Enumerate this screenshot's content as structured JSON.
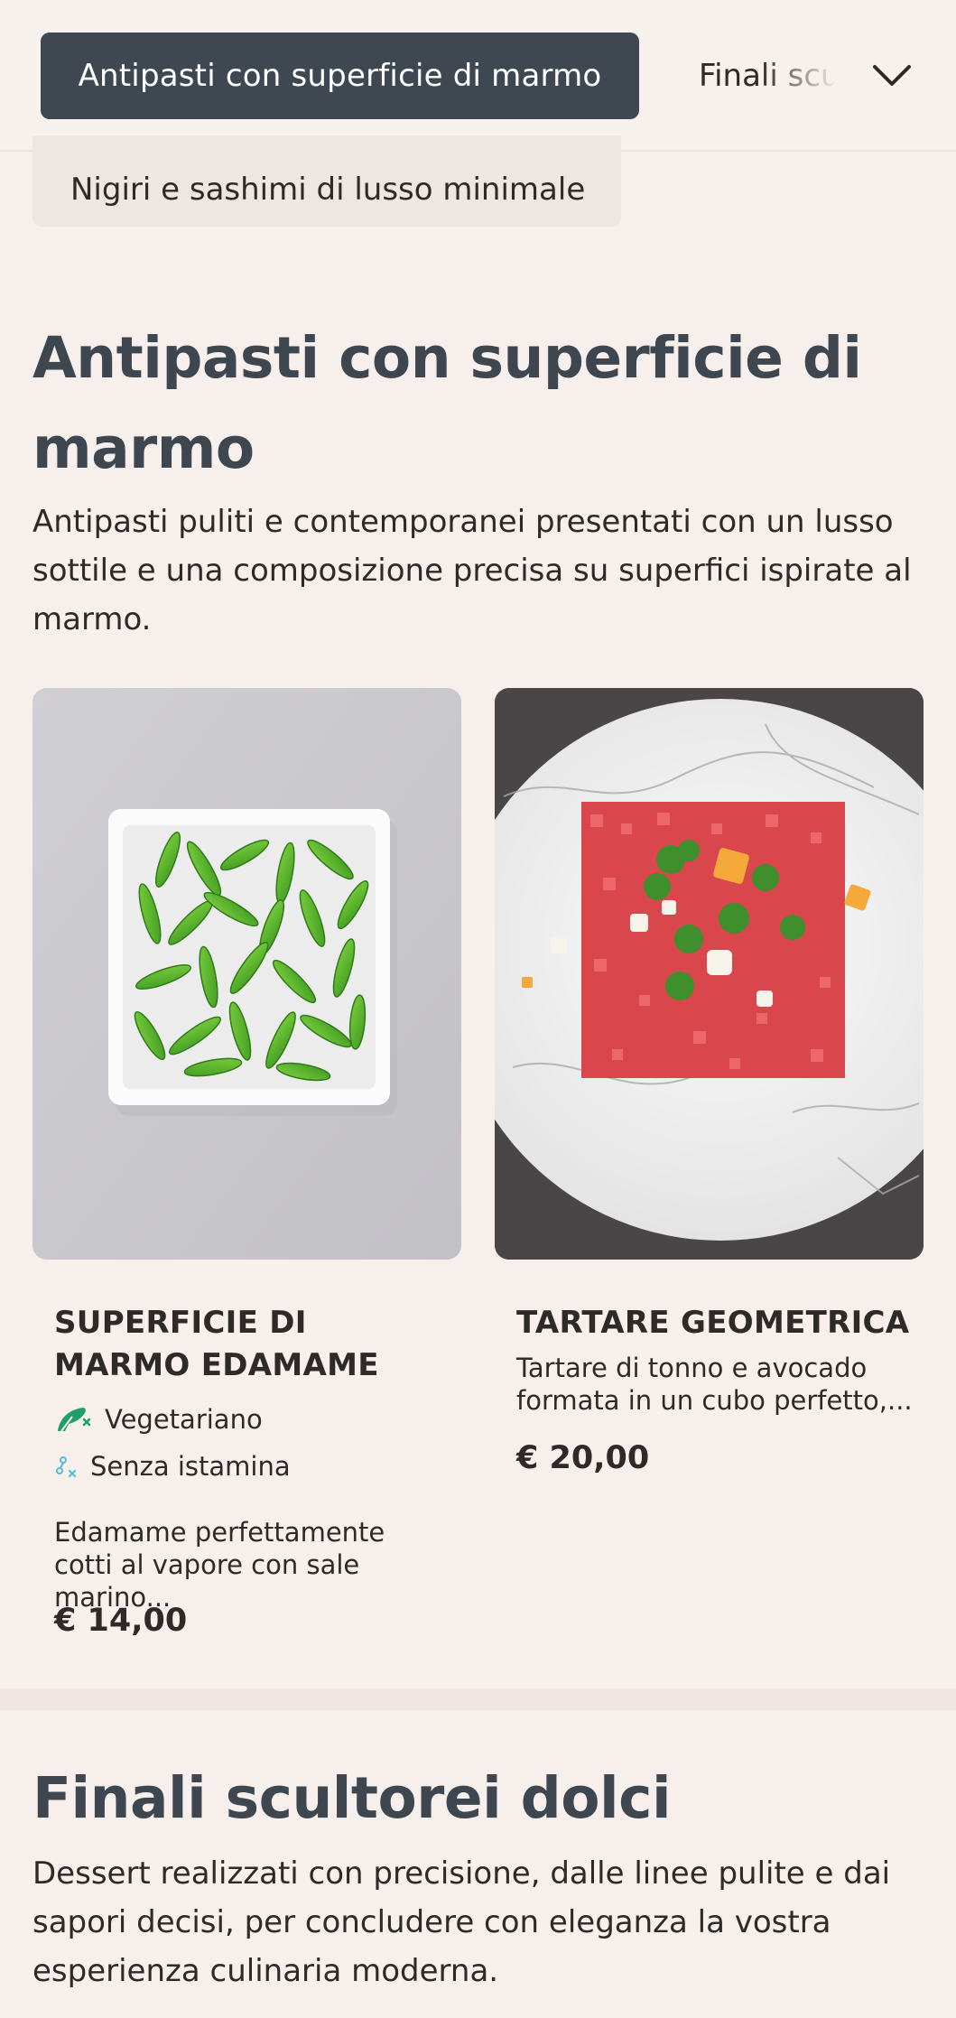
{
  "category_nav": {
    "active": "Antipasti con superficie di marmo",
    "next": "Finali scultorei dolci",
    "secondary_chip": "Nigiri e sashimi di lusso minimale"
  },
  "section_starters": {
    "title": "Antipasti con superficie di marmo",
    "description": "Antipasti puliti e contemporanei presentati con un lusso sottile e una composizione precisa su superfici ispirate al marmo."
  },
  "products": [
    {
      "name": "SUPERFICIE DI MARMO EDAMAME",
      "tags": [
        "Vegetariano",
        "Senza istamina"
      ],
      "description": "Edamame perfettamente cotti al vapore con sale marino...",
      "price": "€ 14,00"
    },
    {
      "name": "TARTARE GEOMETRICA",
      "description": "Tartare di tonno e avocado formata in un cubo perfetto,...",
      "price": "€ 20,00"
    }
  ],
  "section_desserts": {
    "title": "Finali scultorei dolci",
    "description": "Dessert realizzati con precisione, dalle linee pulite e dai sapori decisi, per concludere con eleganza la vostra esperienza culinaria moderna."
  },
  "colors": {
    "page_bg": "#f6efeb",
    "active_tab_bg": "#3f4750",
    "heading": "#3e4650",
    "vegetarian_icon": "#1f9e6e",
    "histamine_icon": "#4fc1d6"
  },
  "icons": {
    "dropdown": "chevron-down-icon",
    "vegetarian": "leaf-icon",
    "histamine_free": "histamine-free-icon"
  }
}
